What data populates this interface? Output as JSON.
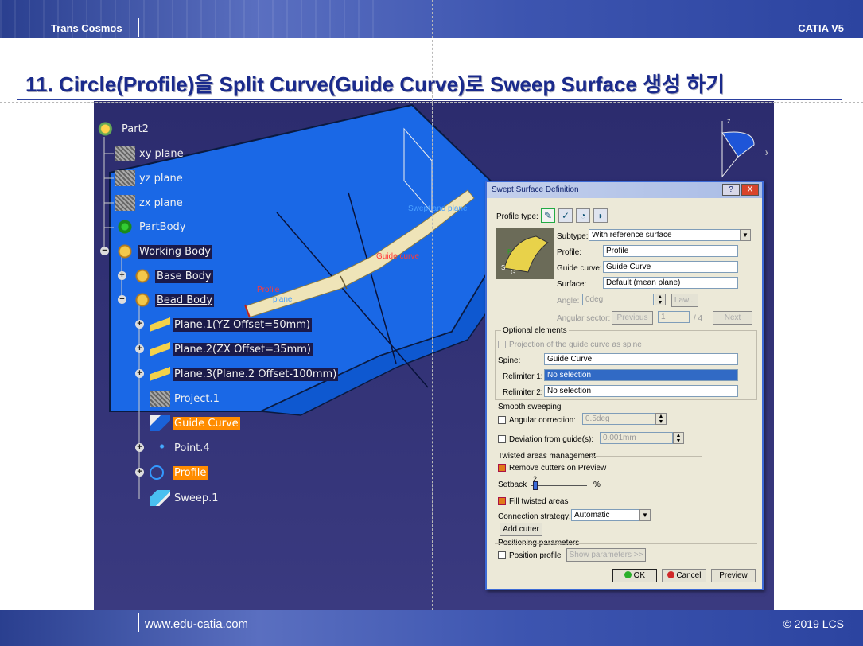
{
  "header": {
    "brand": "Trans Cosmos",
    "product": "CATIA V5"
  },
  "title": "11. Circle(Profile)을 Split Curve(Guide Curve)로 Sweep Surface 생성 하기",
  "footer": {
    "site": "www.edu-catia.com",
    "copyright": "© 2019 LCS"
  },
  "tree": {
    "root": "Part2",
    "items": [
      "xy plane",
      "yz plane",
      "zx plane",
      "PartBody",
      "Working Body",
      "Base Body",
      "Bead Body",
      "Plane.1(YZ Offset=50mm)",
      "Plane.2(ZX Offset=35mm)",
      "Plane.3(Plane.2 Offset-100mm)",
      "Project.1",
      "Guide Curve",
      "Point.4",
      "Profile",
      "Sweep.1"
    ]
  },
  "scene": {
    "guide_label": "Guide curve",
    "profile_label": "Profile",
    "plane_label": "Swept and plane",
    "plane2_label": "plane",
    "axis_z": "z",
    "axis_y": "y"
  },
  "dialog": {
    "title": "Swept Surface Definition",
    "help": "?",
    "close": "X",
    "profile_type_label": "Profile type:",
    "subtype_label": "Subtype:",
    "subtype_value": "With reference surface",
    "profile_label": "Profile:",
    "profile_value": "Profile",
    "guide_label": "Guide curve:",
    "guide_value": "Guide Curve",
    "surface_label": "Surface:",
    "surface_value": "Default (mean plane)",
    "angle_label": "Angle:",
    "angle_value": "0deg",
    "law_button": "Law...",
    "sector_label": "Angular sector:",
    "previous_button": "Previous",
    "sector_value": "1",
    "sector_total": "/ 4",
    "next_button": "Next",
    "optional_title": "Optional elements",
    "projection_label": "Projection of the guide curve as spine",
    "spine_label": "Spine:",
    "spine_value": "Guide Curve",
    "relimiter1_label": "Relimiter 1:",
    "relimiter1_value": "No selection",
    "relimiter2_label": "Relimiter 2:",
    "relimiter2_value": "No selection",
    "smooth_title": "Smooth sweeping",
    "angular_correction_label": "Angular correction:",
    "angular_correction_value": "0.5deg",
    "deviation_label": "Deviation from guide(s):",
    "deviation_value": "0.001mm",
    "twisted_title": "Twisted areas management",
    "remove_cutters_label": "Remove cutters on Preview",
    "setback_label": "Setback",
    "setback_value": "2",
    "setback_unit": "%",
    "fill_twisted_label": "Fill twisted areas",
    "connection_label": "Connection strategy:",
    "connection_value": "Automatic",
    "add_cutter_button": "Add cutter",
    "positioning_title": "Positioning parameters",
    "position_profile_label": "Position profile",
    "show_params_button": "Show parameters >>",
    "ok_button": "OK",
    "cancel_button": "Cancel",
    "preview_button": "Preview"
  }
}
